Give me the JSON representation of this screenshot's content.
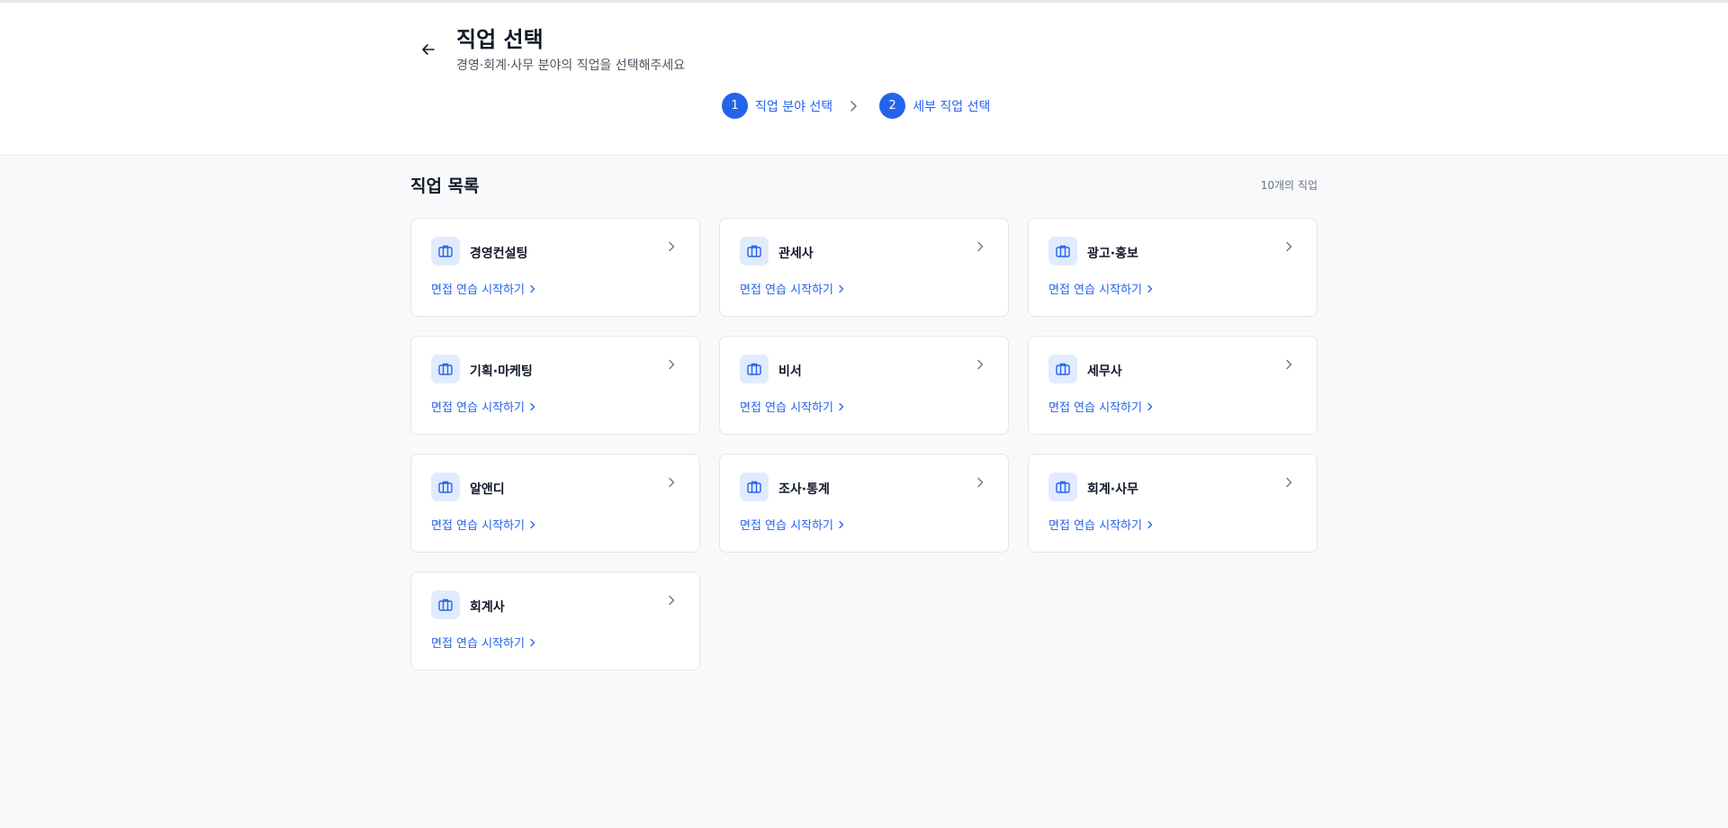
{
  "header": {
    "title": "직업 선택",
    "subtitle": "경영·회계·사무 분야의 직업을 선택해주세요",
    "steps": [
      {
        "num": "1",
        "label": "직업 분야 선택"
      },
      {
        "num": "2",
        "label": "세부 직업 선택"
      }
    ]
  },
  "list": {
    "title": "직업 목록",
    "count": "10개의 직업",
    "link_label": "면접 연습 시작하기",
    "jobs": [
      {
        "name": "경영컨설팅"
      },
      {
        "name": "관세사"
      },
      {
        "name": "광고·홍보"
      },
      {
        "name": "기획·마케팅"
      },
      {
        "name": "비서"
      },
      {
        "name": "세무사"
      },
      {
        "name": "알앤디"
      },
      {
        "name": "조사·통계"
      },
      {
        "name": "회계·사무"
      },
      {
        "name": "회계사"
      }
    ]
  },
  "icons": {
    "back": "arrow-left-icon",
    "step_separator": "chevron-right-icon",
    "job": "briefcase-icon",
    "card_arrow": "chevron-right-icon"
  },
  "colors": {
    "accent": "#2563eb",
    "icon_bg": "#e0ebfd",
    "page_bg": "#f8f9fb"
  }
}
